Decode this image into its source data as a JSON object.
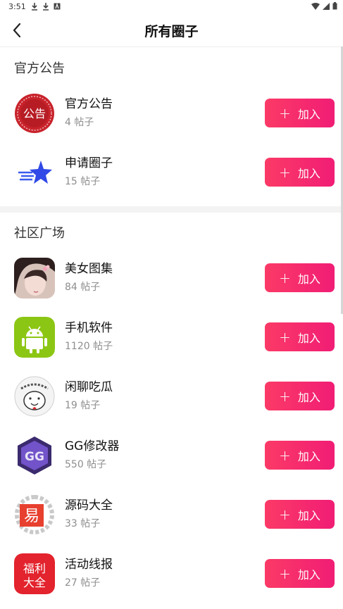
{
  "status_bar": {
    "time": "3:51"
  },
  "header": {
    "title": "所有圈子"
  },
  "join_label": "加入",
  "join_icon": "plus-icon",
  "colors": {
    "accent_start": "#fb3a66",
    "accent_end": "#f11d75"
  },
  "sections": [
    {
      "title": "官方公告",
      "items": [
        {
          "name": "官方公告",
          "count": "4 帖子",
          "icon": "announcement-seal-icon",
          "icon_text": "公告"
        },
        {
          "name": "申请圈子",
          "count": "15 帖子",
          "icon": "shooting-star-icon"
        }
      ]
    },
    {
      "title": "社区广场",
      "items": [
        {
          "name": "美女图集",
          "count": "84 帖子",
          "icon": "girl-photo-avatar"
        },
        {
          "name": "手机软件",
          "count": "1120 帖子",
          "icon": "android-icon"
        },
        {
          "name": "闲聊吃瓜",
          "count": "19 帖子",
          "icon": "cartoon-face-icon"
        },
        {
          "name": "GG修改器",
          "count": "550 帖子",
          "icon": "gg-hexagon-icon",
          "icon_text": "GG"
        },
        {
          "name": "源码大全",
          "count": "33 帖子",
          "icon": "source-code-logo-icon",
          "icon_text": "易"
        },
        {
          "name": "活动线报",
          "count": "27 帖子",
          "icon": "welfare-icon",
          "icon_text": "福利大全"
        }
      ]
    }
  ]
}
